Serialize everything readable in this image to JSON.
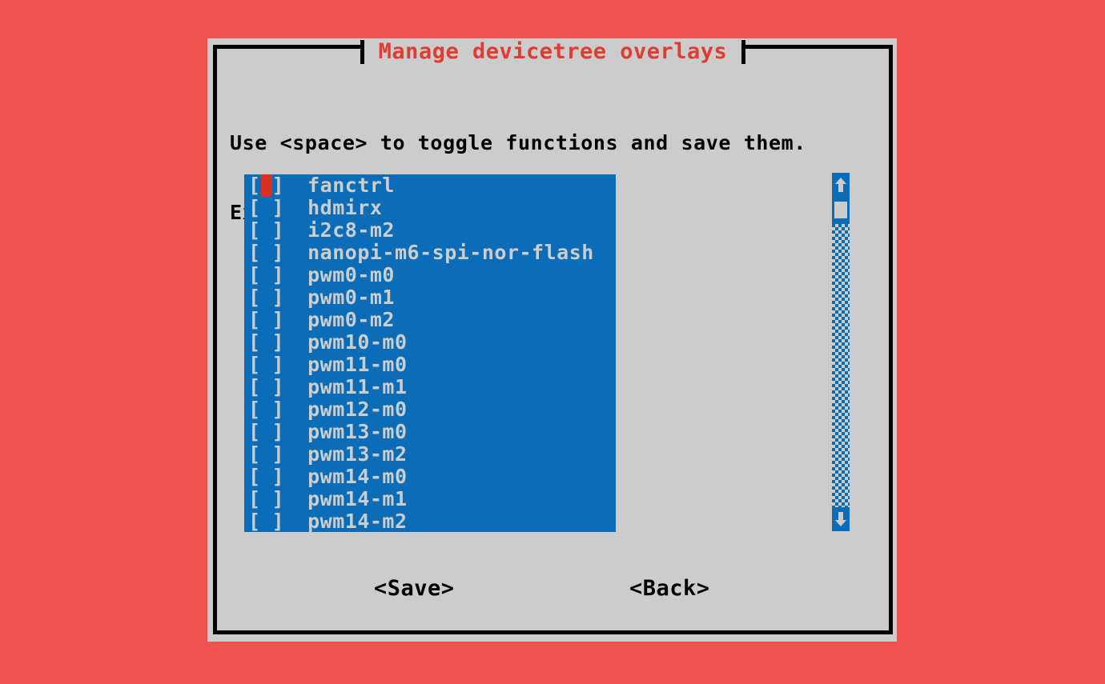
{
  "background_color": "#ef5350",
  "dialog": {
    "title": "Manage devicetree overlays",
    "title_color": "#e03c31",
    "background_color": "#cccccc",
    "border_color": "#000000",
    "instructions": {
      "line1": "Use <space> to toggle functions and save them.",
      "line2": "Exit when you are done."
    }
  },
  "list": {
    "background_color": "#0b6cb8",
    "text_color": "#cdcdcd",
    "cursor_color": "#d93025",
    "bracket_open": "[",
    "bracket_close": "]",
    "unchecked_mark": " ",
    "checked_mark": "*",
    "cursor_index": 0,
    "items": [
      {
        "label": "fanctrl",
        "checked": false
      },
      {
        "label": "hdmirx",
        "checked": false
      },
      {
        "label": "i2c8-m2",
        "checked": false
      },
      {
        "label": "nanopi-m6-spi-nor-flash",
        "checked": false
      },
      {
        "label": "pwm0-m0",
        "checked": false
      },
      {
        "label": "pwm0-m1",
        "checked": false
      },
      {
        "label": "pwm0-m2",
        "checked": false
      },
      {
        "label": "pwm10-m0",
        "checked": false
      },
      {
        "label": "pwm11-m0",
        "checked": false
      },
      {
        "label": "pwm11-m1",
        "checked": false
      },
      {
        "label": "pwm12-m0",
        "checked": false
      },
      {
        "label": "pwm13-m0",
        "checked": false
      },
      {
        "label": "pwm13-m2",
        "checked": false
      },
      {
        "label": "pwm14-m0",
        "checked": false
      },
      {
        "label": "pwm14-m1",
        "checked": false
      },
      {
        "label": "pwm14-m2",
        "checked": false
      }
    ]
  },
  "scrollbar": {
    "up_arrow_icon": "arrow-up-icon",
    "down_arrow_icon": "arrow-down-icon",
    "thumb_position_percent": 0,
    "track_color": "#0b6cb8",
    "thumb_color": "#cdcdcd"
  },
  "buttons": {
    "save": "<Save>",
    "back": "<Back>"
  }
}
